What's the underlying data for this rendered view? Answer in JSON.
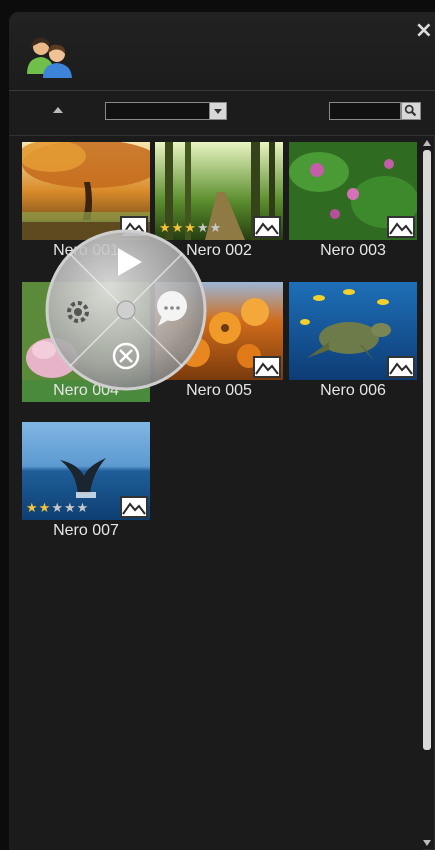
{
  "window": {
    "close_glyph": "×"
  },
  "toolbar": {
    "sort_icon": "triangle-up-icon",
    "combo_value": "",
    "search_value": "",
    "search_icon": "search-icon"
  },
  "items": [
    {
      "label": "Nero 001",
      "type_icon": "image-icon",
      "rating": 0
    },
    {
      "label": "Nero 002",
      "type_icon": "image-icon",
      "rating": 3
    },
    {
      "label": "Nero 003",
      "type_icon": "image-icon",
      "rating": 0
    },
    {
      "label": "Nero 004",
      "type_icon": "image-icon",
      "rating": 0,
      "selected": true
    },
    {
      "label": "Nero 005",
      "type_icon": "image-icon",
      "rating": 0
    },
    {
      "label": "Nero 006",
      "type_icon": "image-icon",
      "rating": 0
    },
    {
      "label": "Nero 007",
      "type_icon": "image-icon",
      "rating": 2
    }
  ],
  "radial_menu": {
    "items": [
      "play-icon",
      "comment-icon",
      "delete-icon",
      "settings-icon"
    ]
  },
  "colors": {
    "selection": "#4a8a3c",
    "background": "#1b1b1b",
    "star": "#f2c23a"
  }
}
